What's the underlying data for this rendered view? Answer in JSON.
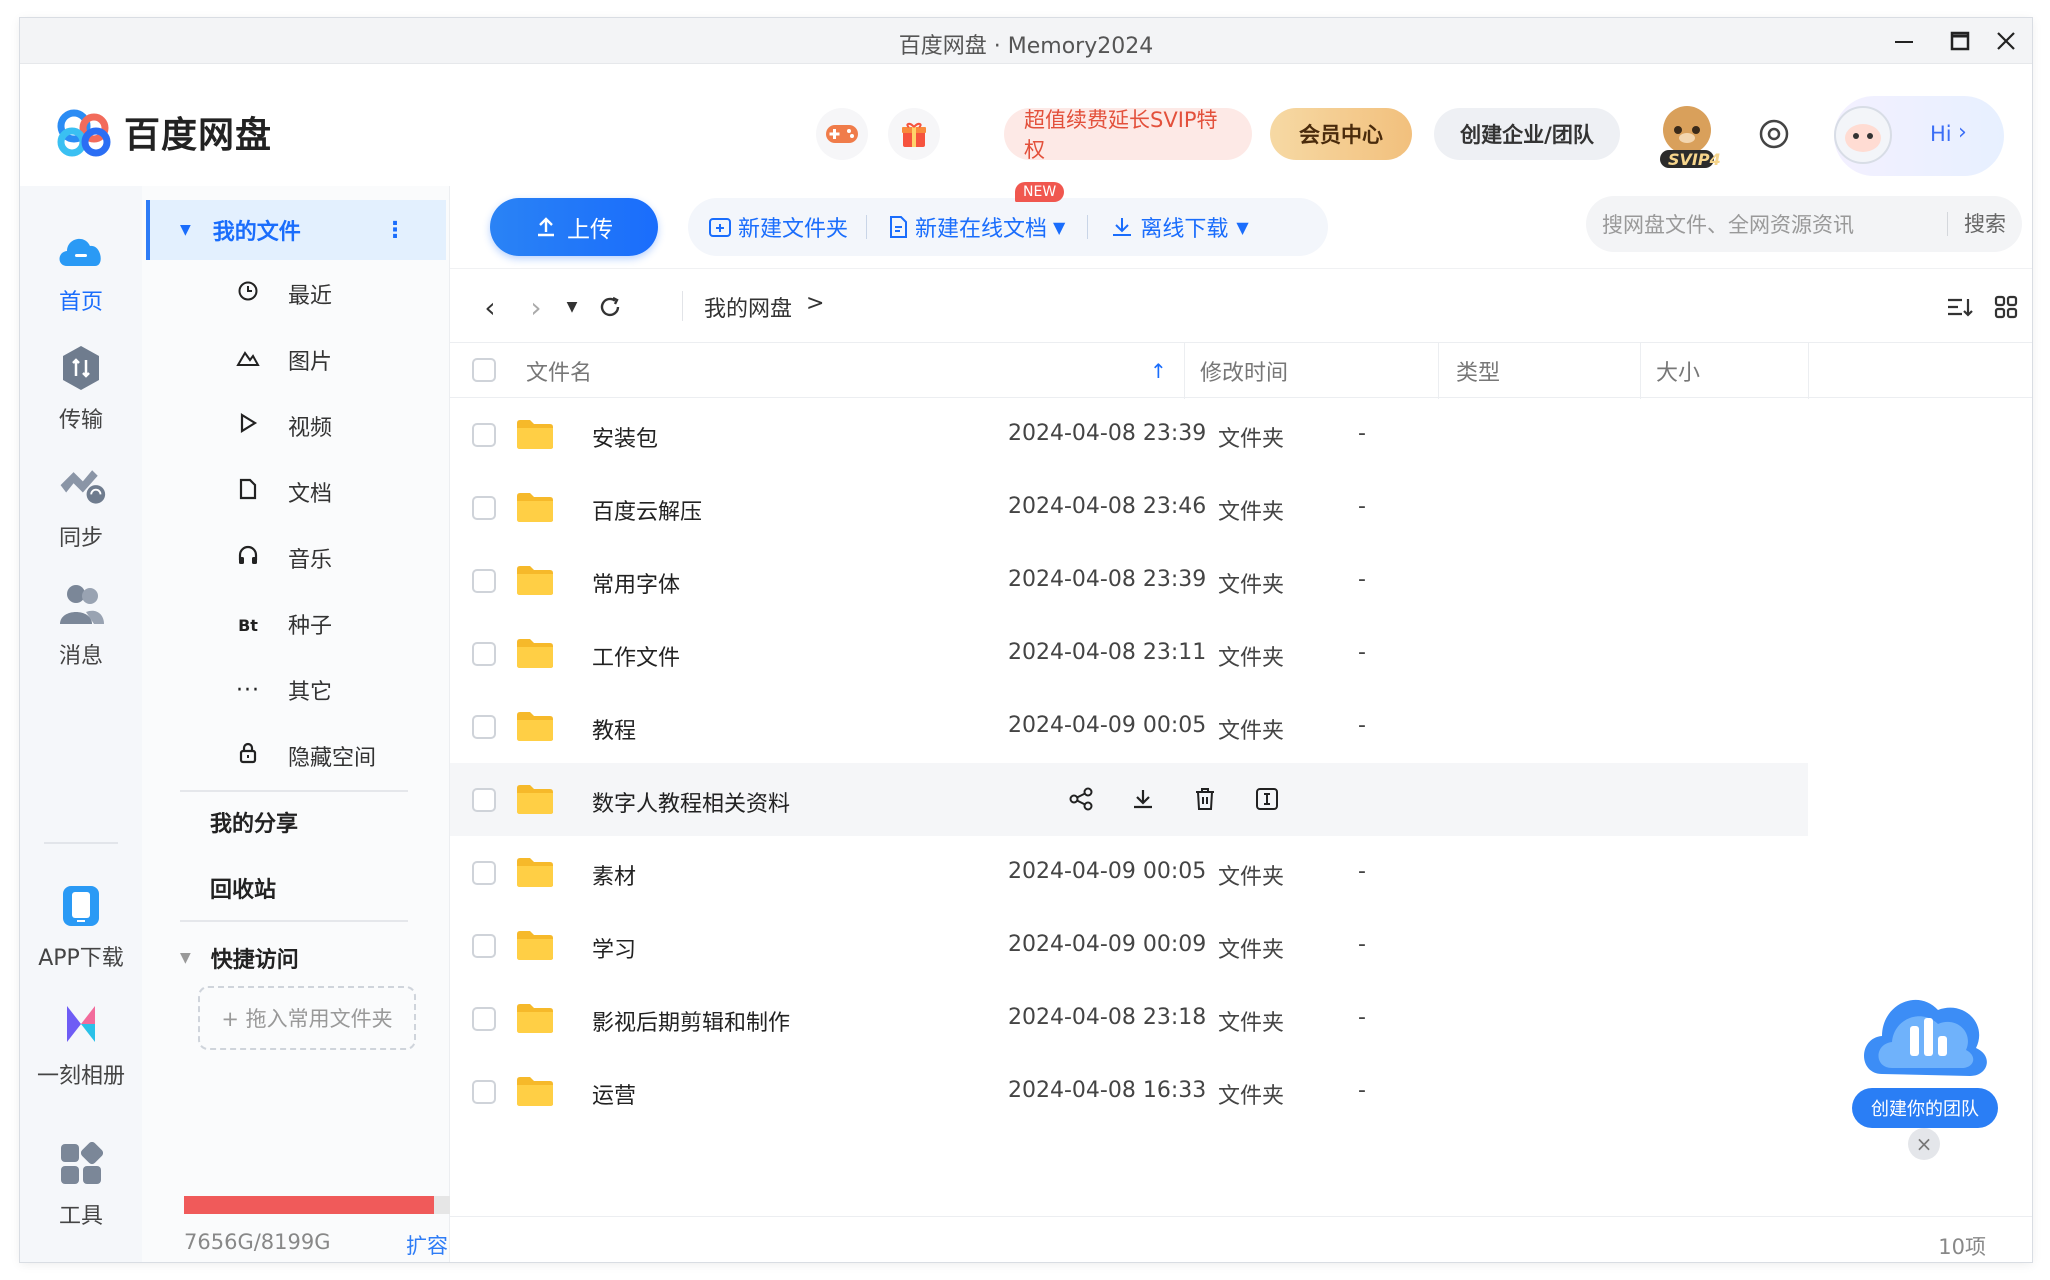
{
  "window": {
    "title": "百度网盘 · Memory2024"
  },
  "header": {
    "app_name": "百度网盘",
    "promo_label": "超值续费延长SVIP特权",
    "vip_center": "会员中心",
    "create_team": "创建企业/团队",
    "svip_badge": "SVIP4",
    "greeting": "Hi"
  },
  "rail": {
    "items": [
      {
        "label": "首页",
        "icon": "cloud-icon"
      },
      {
        "label": "传输",
        "icon": "transfer-icon"
      },
      {
        "label": "同步",
        "icon": "sync-icon"
      },
      {
        "label": "消息",
        "icon": "message-icon"
      },
      {
        "label": "APP下载",
        "icon": "phone-icon"
      },
      {
        "label": "一刻相册",
        "icon": "album-icon"
      },
      {
        "label": "工具",
        "icon": "tools-icon"
      }
    ]
  },
  "sidebar": {
    "my_files": "我的文件",
    "items": [
      {
        "label": "最近",
        "icon": "clock-icon"
      },
      {
        "label": "图片",
        "icon": "image-icon"
      },
      {
        "label": "视频",
        "icon": "play-icon"
      },
      {
        "label": "文档",
        "icon": "doc-icon"
      },
      {
        "label": "音乐",
        "icon": "headphones-icon"
      },
      {
        "label": "种子",
        "icon": "bt-icon"
      },
      {
        "label": "其它",
        "icon": "more-icon"
      },
      {
        "label": "隐藏空间",
        "icon": "lock-icon"
      }
    ],
    "bt_glyph": "Bt",
    "my_share": "我的分享",
    "recycle": "回收站",
    "quick_access": "快捷访问",
    "drop_hint": "+ 拖入常用文件夹",
    "quota_text": "7656G/8199G",
    "quota_used_fraction": 0.934,
    "expand": "扩容"
  },
  "toolbar": {
    "upload": "上传",
    "new_folder": "新建文件夹",
    "new_online_doc": "新建在线文档",
    "new_badge": "NEW",
    "offline_download": "离线下载",
    "search_placeholder": "搜网盘文件、全网资源资讯",
    "search_button": "搜索"
  },
  "breadcrumb": {
    "root": "我的网盘",
    "sep": ">"
  },
  "table": {
    "headers": {
      "name": "文件名",
      "mtime": "修改时间",
      "type": "类型",
      "size": "大小"
    },
    "rows": [
      {
        "name": "安装包",
        "mtime": "2024-04-08 23:39",
        "type": "文件夹",
        "size": "-"
      },
      {
        "name": "百度云解压",
        "mtime": "2024-04-08 23:46",
        "type": "文件夹",
        "size": "-"
      },
      {
        "name": "常用字体",
        "mtime": "2024-04-08 23:39",
        "type": "文件夹",
        "size": "-"
      },
      {
        "name": "工作文件",
        "mtime": "2024-04-08 23:11",
        "type": "文件夹",
        "size": "-"
      },
      {
        "name": "教程",
        "mtime": "2024-04-09 00:05",
        "type": "文件夹",
        "size": "-"
      },
      {
        "name": "数字人教程相关资料",
        "mtime": "",
        "type": "",
        "size": ""
      },
      {
        "name": "素材",
        "mtime": "2024-04-09 00:05",
        "type": "文件夹",
        "size": "-"
      },
      {
        "name": "学习",
        "mtime": "2024-04-09 00:09",
        "type": "文件夹",
        "size": "-"
      },
      {
        "name": "影视后期剪辑和制作",
        "mtime": "2024-04-08 23:18",
        "type": "文件夹",
        "size": "-"
      },
      {
        "name": "运营",
        "mtime": "2024-04-08 16:33",
        "type": "文件夹",
        "size": "-"
      }
    ]
  },
  "footer": {
    "count": "10项"
  },
  "promo": {
    "label": "创建你的团队"
  },
  "colors": {
    "accent": "#1a6dfc",
    "folder": "#ffc940",
    "quota": "#f05a5a"
  }
}
